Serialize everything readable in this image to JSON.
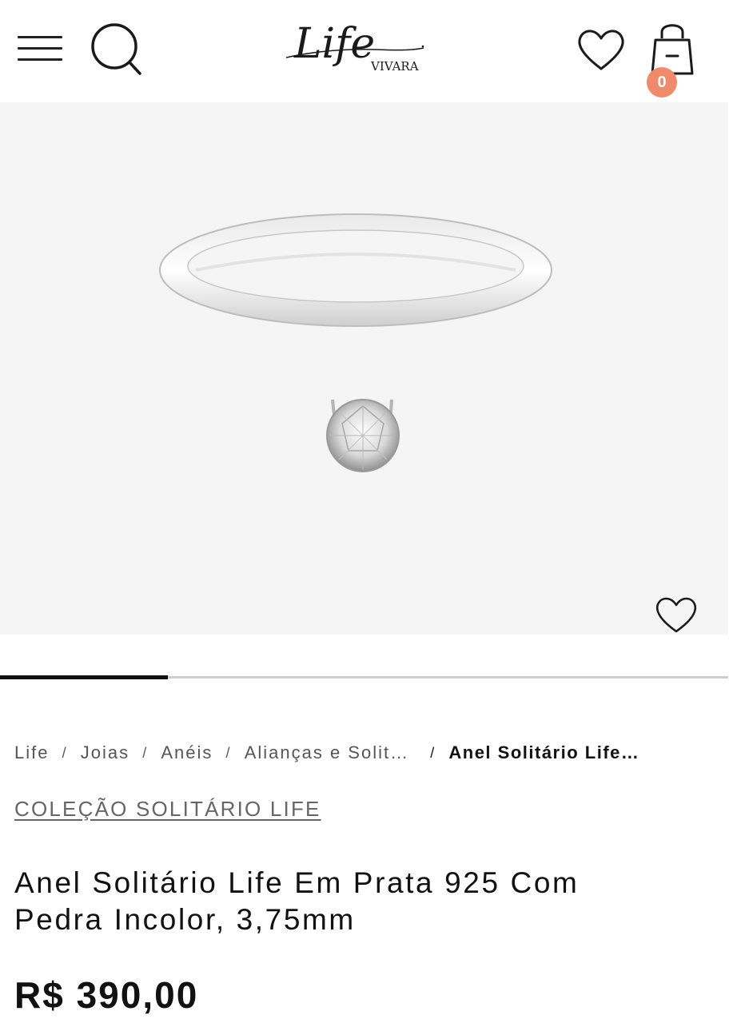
{
  "header": {
    "logo_text": "Life",
    "logo_subtext": "VIVARA",
    "cart_count": "0",
    "icons": [
      "menu-icon",
      "search-icon",
      "heart-icon",
      "shopping-bag-icon"
    ]
  },
  "gallery": {
    "image": "ring-solitaire",
    "favorite_icon": "heart-icon",
    "progress": 0.23
  },
  "breadcrumb": {
    "items": [
      "Life",
      "Joias",
      "Anéis",
      "Alianças e Solit…"
    ],
    "separator": "/",
    "current": "Anel Solitário Life…"
  },
  "product": {
    "collection": "COLEÇÃO SOLITÁRIO LIFE",
    "title_line1": "Anel Solitário Life Em Prata 925 Com",
    "title_line2": "Pedra Incolor, 3,75mm",
    "price": "R$ 390,00"
  },
  "colors": {
    "badge": "#ef8a6a",
    "gallery_bg": "#f5f5f5",
    "text": "#111111"
  }
}
